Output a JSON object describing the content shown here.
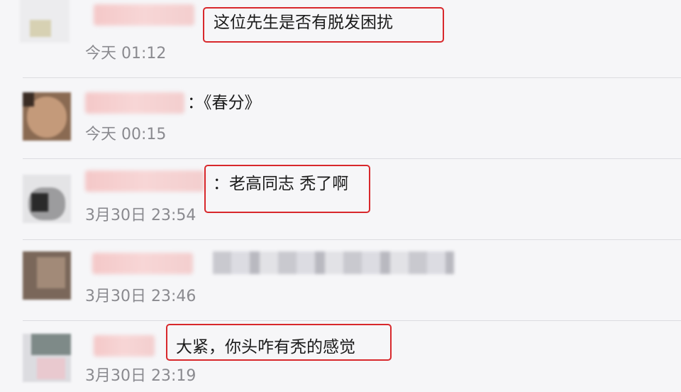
{
  "comments": [
    {
      "text": "这位先生是否有脱发困扰",
      "time": "今天 01:12",
      "highlighted": true
    },
    {
      "text": "：《春分》",
      "time": "今天 00:15",
      "highlighted": false
    },
    {
      "text": "：老高同志 秃了啊",
      "time": "3月30日 23:54",
      "highlighted": true
    },
    {
      "text": "",
      "time": "3月30日 23:46",
      "highlighted": false
    },
    {
      "text": "大紧，你头咋有秃的感觉",
      "time": "3月30日 23:19",
      "highlighted": true
    }
  ],
  "colors": {
    "background": "#f6f6f8",
    "highlight_border": "#d8282c",
    "time_text": "#8a8a8f",
    "comment_text": "#1b1b1b",
    "redacted_name": "#f4c8c8"
  }
}
